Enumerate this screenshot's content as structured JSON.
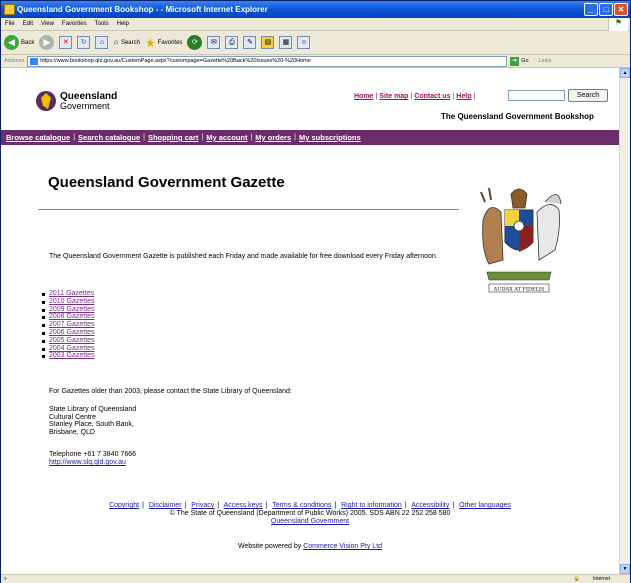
{
  "window": {
    "title": "Queensland Government Bookshop - - Microsoft Internet Explorer",
    "min": "_",
    "max": "□",
    "close": "✕"
  },
  "menu": [
    "File",
    "Edit",
    "View",
    "Favorites",
    "Tools",
    "Help"
  ],
  "toolbar": {
    "back": "Back",
    "search": "Search",
    "favorites": "Favorites"
  },
  "address": {
    "label": "Address",
    "url": "https://www.bookshop.qld.gov.au/CustomPage.aspx?custompage=Gazette%20Back%20Issues%20-%20Home",
    "go": "Go",
    "links": "Links"
  },
  "header": {
    "logo_line1": "Queensland",
    "logo_line2": "Government",
    "top_links": [
      "Home",
      "Site map",
      "Contact us",
      "Help"
    ],
    "search_button": "Search",
    "shop_title": "The Queensland Government Bookshop"
  },
  "nav": [
    "Browse catalogue",
    "Search catalogue",
    "Shopping cart",
    "My account",
    "My orders",
    "My subscriptions"
  ],
  "page": {
    "title": "Queensland Government Gazette",
    "intro": "The Queensland Government Gazette is published each Friday and made available for free download every Friday afternoon.",
    "gazettes": [
      "2011 Gazettes",
      "2010 Gazettes",
      "2009 Gazettes",
      "2008 Gazettes",
      "2007 Gazettes",
      "2006 Gazettes",
      "2005 Gazettes",
      "2004 Gazettes",
      "2003 Gazettes"
    ],
    "older_note": "For Gazettes older than 2003, please contact the State Library of Queensland:",
    "address_lines": [
      "State Library of Queensland",
      "Cultural Centre",
      "Stanley Place, South Bank,",
      "Brisbane, QLD"
    ],
    "telephone": "Telephone +61 7 3840 7666",
    "library_url": "http://www.slq.qld.gov.au",
    "coat_motto": "AUDAX AT FIDELIS"
  },
  "footer": {
    "links": [
      "Copyright",
      "Disclaimer",
      "Privacy",
      "Access keys",
      "Terms & conditions",
      "Right to information",
      "Accessibility",
      "Other languages"
    ],
    "copyright": "© The State of Queensland (Department of Public Works) 2005. SDS ABN 22 252 258 580",
    "gov_link": "Queensland Government",
    "powered_prefix": "Website powered by",
    "powered_link": "Commerce Vision Pty Ltd"
  },
  "status": {
    "zone": "Internet"
  }
}
